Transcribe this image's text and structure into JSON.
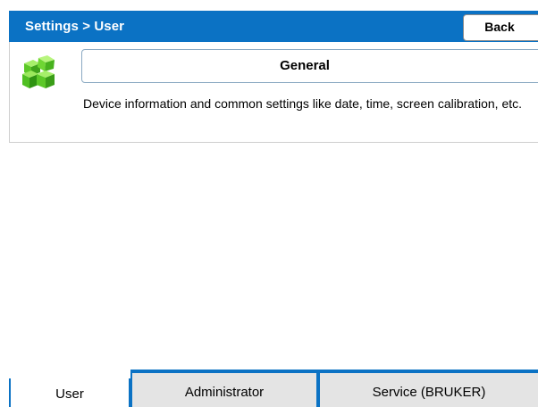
{
  "header": {
    "breadcrumb": "Settings > User",
    "back_label": "Back",
    "accent_color": "#0b72c4"
  },
  "item": {
    "icon": "green-cubes-icon",
    "title": "General",
    "description": "Device information and common settings like date, time, screen calibration, etc."
  },
  "tabs": [
    {
      "label": "User",
      "active": true
    },
    {
      "label": "Administrator",
      "active": false
    },
    {
      "label": "Service (BRUKER)",
      "active": false
    }
  ]
}
